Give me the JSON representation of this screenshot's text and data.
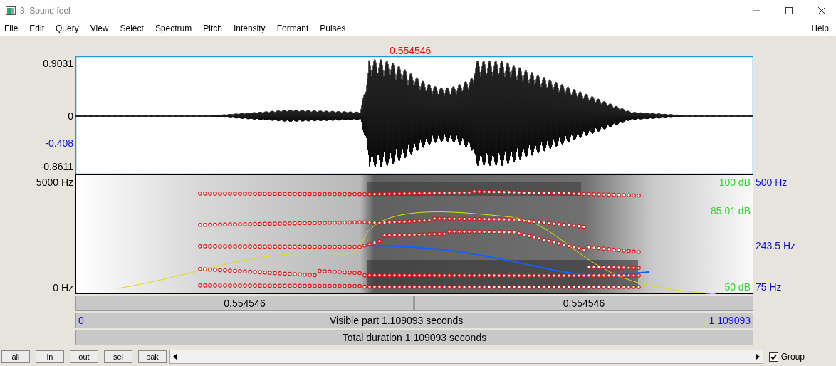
{
  "window": {
    "title": "3. Sound feel"
  },
  "menu": [
    "File",
    "Edit",
    "Query",
    "View",
    "Select",
    "Spectrum",
    "Pitch",
    "Intensity",
    "Formant",
    "Pulses"
  ],
  "help": "Help",
  "cursor_time": "0.554546",
  "waveform": {
    "max": "0.9031",
    "zero": "0",
    "cursor_value": "-0.408",
    "min": "-0.8611"
  },
  "spectrogram": {
    "top": "5000 Hz",
    "bottom": "0 Hz"
  },
  "intensity_labels": [
    "100 dB",
    "85.01 dB",
    "50 dB"
  ],
  "pitch_labels": [
    "500 Hz",
    "243.5 Hz",
    "75 Hz"
  ],
  "selection_bar": [
    "0.554546",
    "0.554546"
  ],
  "visible_bar": {
    "start": "0",
    "label": "Visible part 1.109093 seconds",
    "end": "1.109093"
  },
  "total_bar": "Total duration 1.109093 seconds",
  "buttons": [
    "all",
    "in",
    "out",
    "sel",
    "bak"
  ],
  "group": {
    "label": "Group",
    "checked": true
  }
}
